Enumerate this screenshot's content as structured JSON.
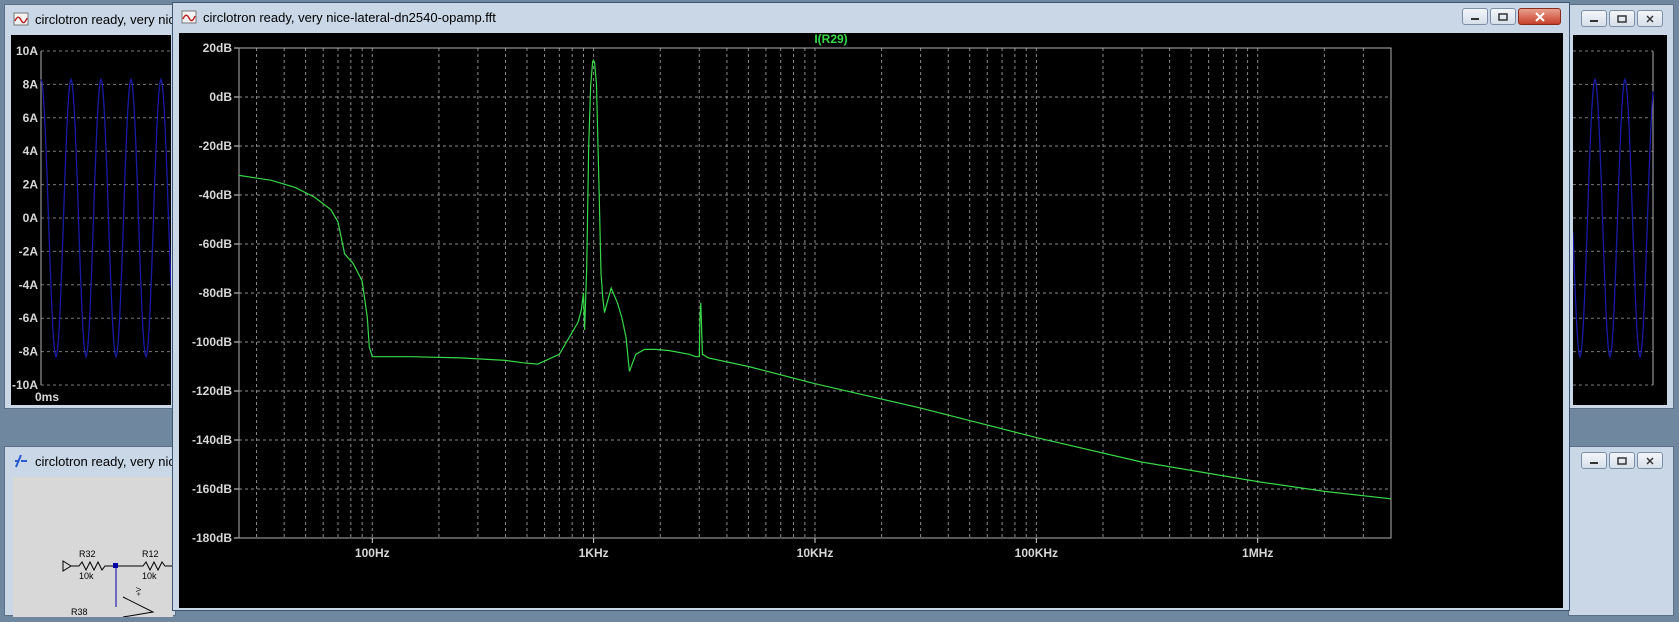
{
  "windows": {
    "back_left": {
      "title": "circlotron ready, very nice-"
    },
    "back_schematic": {
      "title": "circlotron ready, very nice-"
    },
    "front": {
      "title": "circlotron ready, very nice-lateral-dn2540-opamp.fft"
    }
  },
  "back_plot": {
    "y_ticks": [
      "10A",
      "8A",
      "6A",
      "4A",
      "2A",
      "0A",
      "-2A",
      "-4A",
      "-6A",
      "-8A",
      "-10A"
    ],
    "x_tick": "0ms",
    "trace_color": "#1a1aa6",
    "amplitude_A": 8.3
  },
  "schematic": {
    "labels": [
      {
        "text": "R32"
      },
      {
        "text": "10k"
      },
      {
        "text": "R12"
      },
      {
        "text": "10k"
      },
      {
        "text": "R38"
      },
      {
        "text": "+V"
      }
    ]
  },
  "colors": {
    "trace": "#39d84a",
    "grid": "#8a8a8a",
    "background": "#000000",
    "axis_text": "#d8d8d8"
  },
  "chart_data": {
    "type": "line",
    "title": "I(R29)",
    "xlabel": "",
    "ylabel": "",
    "x_scale": "log",
    "x_unit": "Hz",
    "xlim": [
      25,
      4000000
    ],
    "ylim": [
      -180,
      20
    ],
    "x_ticks": [
      {
        "value": 100,
        "label": "100Hz"
      },
      {
        "value": 1000,
        "label": "1KHz"
      },
      {
        "value": 10000,
        "label": "10KHz"
      },
      {
        "value": 100000,
        "label": "100KHz"
      },
      {
        "value": 1000000,
        "label": "1MHz"
      }
    ],
    "y_ticks": [
      {
        "value": 20,
        "label": "20dB"
      },
      {
        "value": 0,
        "label": "0dB"
      },
      {
        "value": -20,
        "label": "-20dB"
      },
      {
        "value": -40,
        "label": "-40dB"
      },
      {
        "value": -60,
        "label": "-60dB"
      },
      {
        "value": -80,
        "label": "-80dB"
      },
      {
        "value": -100,
        "label": "-100dB"
      },
      {
        "value": -120,
        "label": "-120dB"
      },
      {
        "value": -140,
        "label": "-140dB"
      },
      {
        "value": -160,
        "label": "-160dB"
      },
      {
        "value": -180,
        "label": "-180dB"
      }
    ],
    "grid": true,
    "series": [
      {
        "name": "I(R29)",
        "x": [
          25,
          35,
          45,
          55,
          65,
          70,
          75,
          82,
          90,
          95,
          97,
          100,
          150,
          250,
          400,
          480,
          560,
          700,
          850,
          880,
          900,
          910,
          930,
          950,
          970,
          990,
          1000,
          1010,
          1030,
          1060,
          1080,
          1100,
          1120,
          1150,
          1200,
          1280,
          1340,
          1400,
          1450,
          1550,
          1700,
          1900,
          2200,
          2700,
          2900,
          3000,
          3020,
          3050,
          3100,
          3300,
          5000,
          10000,
          30000,
          100000,
          300000,
          1000000,
          2000000,
          4000000
        ],
        "y": [
          -32,
          -34,
          -37,
          -41,
          -46,
          -51,
          -64,
          -68,
          -75,
          -90,
          -102,
          -106,
          -106,
          -106.5,
          -107.5,
          -108.5,
          -109,
          -105,
          -92,
          -87,
          -80,
          -95,
          -70,
          -20,
          5,
          14.5,
          15,
          14,
          5,
          -40,
          -72,
          -82,
          -88,
          -84,
          -78,
          -84,
          -90,
          -98,
          -112,
          -105,
          -103,
          -103,
          -103.5,
          -105,
          -106,
          -106,
          -91,
          -84,
          -105,
          -106.5,
          -110,
          -117,
          -127,
          -139,
          -149,
          -157,
          -161,
          -164
        ]
      }
    ]
  }
}
